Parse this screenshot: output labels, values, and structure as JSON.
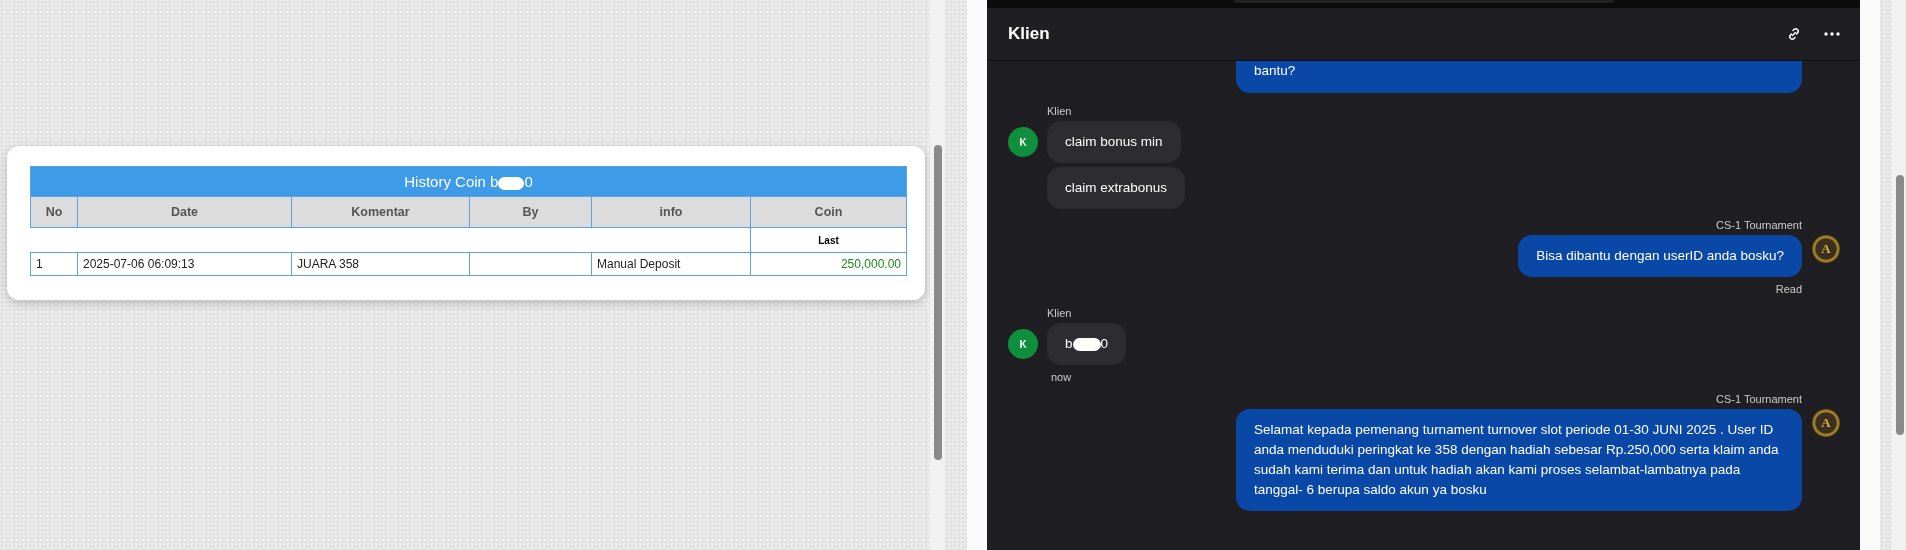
{
  "history_panel": {
    "table": {
      "title": {
        "text_before": "History Coin b",
        "text_after": "0",
        "redacted": true
      },
      "columns": [
        "No",
        "Date",
        "Komentar",
        "By",
        "info",
        "Coin"
      ],
      "subheader": "Last",
      "rows": [
        {
          "no": "1",
          "date": "2025-07-06 06:09:13",
          "komentar": "JUARA 358",
          "info": "Manual Deposit",
          "coin": "250,000.00"
        }
      ]
    }
  },
  "chat": {
    "title": "Klien",
    "messages": [
      {
        "kind": "outgoing",
        "partial": true,
        "bubbles": [
          {
            "text": "bantu?"
          }
        ]
      },
      {
        "kind": "incoming",
        "sender": "Klien",
        "avatar": "K",
        "bubbles": [
          {
            "text": "claim bonus min"
          },
          {
            "text": "claim extrabonus"
          }
        ]
      },
      {
        "kind": "outgoing",
        "sender": "CS-1 Tournament",
        "avatar": "A",
        "bubbles": [
          {
            "text": "Bisa dibantu dengan userID anda bosku?"
          }
        ],
        "status": "Read"
      },
      {
        "kind": "incoming",
        "sender": "Klien",
        "avatar": "K",
        "bubbles": [
          {
            "text_before": "b",
            "text_after": "0",
            "redacted": true
          }
        ],
        "time": "now"
      },
      {
        "kind": "outgoing",
        "sender": "CS-1 Tournament",
        "avatar": "A",
        "bubbles": [
          {
            "text": "Selamat kepada pemenang turnament turnover slot periode 01-30 JUNI 2025 . User ID anda menduduki peringkat ke 358 dengan hadiah sebesar Rp.250,000 serta klaim anda sudah kami terima dan untuk hadiah akan kami proses selambat-lambatnya pada tanggal- 6 berupa saldo akun ya bosku"
          }
        ]
      }
    ]
  }
}
